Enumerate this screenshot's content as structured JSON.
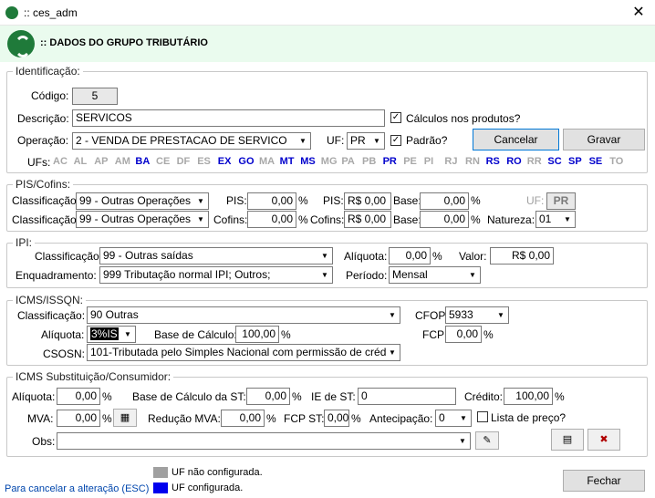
{
  "window": {
    "title": ":: ces_adm",
    "close_glyph": "✕"
  },
  "header": {
    "title": ":: DADOS DO GRUPO TRIBUTÁRIO"
  },
  "identificacao": {
    "legend": "Identificação:",
    "codigo_label": "Código:",
    "codigo_value": "5",
    "descricao_label": "Descrição:",
    "descricao_value": "SERVICOS",
    "calculos_label": "Cálculos nos produtos?",
    "calculos_checked": "✓",
    "operacao_label": "Operação:",
    "operacao_value": "2 - VENDA DE PRESTACAO DE SERVICO",
    "uf_label": "UF:",
    "uf_value": "PR",
    "padrao_label": "Padrão?",
    "padrao_checked": "✓",
    "cancelar_label": "Cancelar",
    "gravar_label": "Gravar",
    "ufs_label": "UFs:",
    "ufs": [
      {
        "code": "AC",
        "on": false
      },
      {
        "code": "AL",
        "on": false
      },
      {
        "code": "AP",
        "on": false
      },
      {
        "code": "AM",
        "on": false
      },
      {
        "code": "BA",
        "on": true
      },
      {
        "code": "CE",
        "on": false
      },
      {
        "code": "DF",
        "on": false
      },
      {
        "code": "ES",
        "on": false
      },
      {
        "code": "EX",
        "on": true
      },
      {
        "code": "GO",
        "on": true
      },
      {
        "code": "MA",
        "on": false
      },
      {
        "code": "MT",
        "on": true
      },
      {
        "code": "MS",
        "on": true
      },
      {
        "code": "MG",
        "on": false
      },
      {
        "code": "PA",
        "on": false
      },
      {
        "code": "PB",
        "on": false
      },
      {
        "code": "PR",
        "on": true
      },
      {
        "code": "PE",
        "on": false
      },
      {
        "code": "PI",
        "on": false
      },
      {
        "code": "RJ",
        "on": false
      },
      {
        "code": "RN",
        "on": false
      },
      {
        "code": "RS",
        "on": true
      },
      {
        "code": "RO",
        "on": true
      },
      {
        "code": "RR",
        "on": false
      },
      {
        "code": "SC",
        "on": true
      },
      {
        "code": "SP",
        "on": true
      },
      {
        "code": "SE",
        "on": true
      },
      {
        "code": "TO",
        "on": false
      }
    ]
  },
  "piscofins": {
    "legend": "PIS/Cofins:",
    "class1_label": "Classificação:",
    "class1_value": "99 - Outras Operações",
    "pis_label": "PIS:",
    "pis_value": "0,00",
    "pct1": "%",
    "pis2_label": "PIS:",
    "pis2_value": "R$ 0,00",
    "base1_label": "Base:",
    "base1_value": "0,00",
    "pct2": "%",
    "uf_label": "UF:",
    "uf_value": "PR",
    "class2_label": "Classificação:",
    "class2_value": "99 - Outras Operações",
    "cofins_label": "Cofins:",
    "cofins_value": "0,00",
    "pct3": "%",
    "cofins2_label": "Cofins:",
    "cofins2_value": "R$ 0,00",
    "base2_label": "Base:",
    "base2_value": "0,00",
    "pct4": "%",
    "natureza_label": "Natureza:",
    "natureza_value": "01"
  },
  "ipi": {
    "legend": "IPI:",
    "class_label": "Classificação:",
    "class_value": "99 - Outras saídas",
    "aliquota_label": "Alíquota:",
    "aliquota_value": "0,00",
    "pct": "%",
    "valor_label": "Valor:",
    "valor_value": "R$ 0,00",
    "enq_label": "Enquadramento:",
    "enq_value": "999 Tributação normal IPI; Outros;",
    "periodo_label": "Período:",
    "periodo_value": "Mensal"
  },
  "icms": {
    "legend": "ICMS/ISSQN:",
    "class_label": "Classificação:",
    "class_value": "90 Outras",
    "cfop_label": "CFOP:",
    "cfop_value": "5933",
    "aliquota_label": "Alíquota:",
    "aliquota_value": "3%IS",
    "base_label": "Base de Cálculo:",
    "base_value": "100,00",
    "pct1": "%",
    "fcp_label": "FCP:",
    "fcp_value": "0,00",
    "pct2": "%",
    "csosn_label": "CSOSN:",
    "csosn_value": "101-Tributada pelo Simples Nacional com permissão de créd"
  },
  "st": {
    "legend": "ICMS Substituição/Consumidor:",
    "aliquota_label": "Alíquota:",
    "aliquota_value": "0,00",
    "pct1": "%",
    "base_label": "Base de Cálculo da ST:",
    "base_value": "0,00",
    "pct2": "%",
    "ie_label": "IE de ST:",
    "ie_value": "0",
    "credito_label": "Crédito:",
    "credito_value": "100,00",
    "pct3": "%",
    "mva_label": "MVA:",
    "mva_value": "0,00",
    "pct4": "%",
    "red_label": "Redução MVA:",
    "red_value": "0,00",
    "pct5": "%",
    "fcpst_label": "FCP ST:",
    "fcpst_value": "0,00",
    "pct6": "%",
    "ant_label": "Antecipação:",
    "ant_value": "0",
    "lista_label": "Lista de preço?",
    "obs_label": "Obs:",
    "obs_value": ""
  },
  "footer": {
    "hint": "Para cancelar a alteração (ESC)",
    "legend_gray": "UF não configurada.",
    "legend_blue": "UF configurada.",
    "fechar_label": "Fechar",
    "gray_color": "#a0a0a0",
    "blue_color": "#0000ee"
  }
}
